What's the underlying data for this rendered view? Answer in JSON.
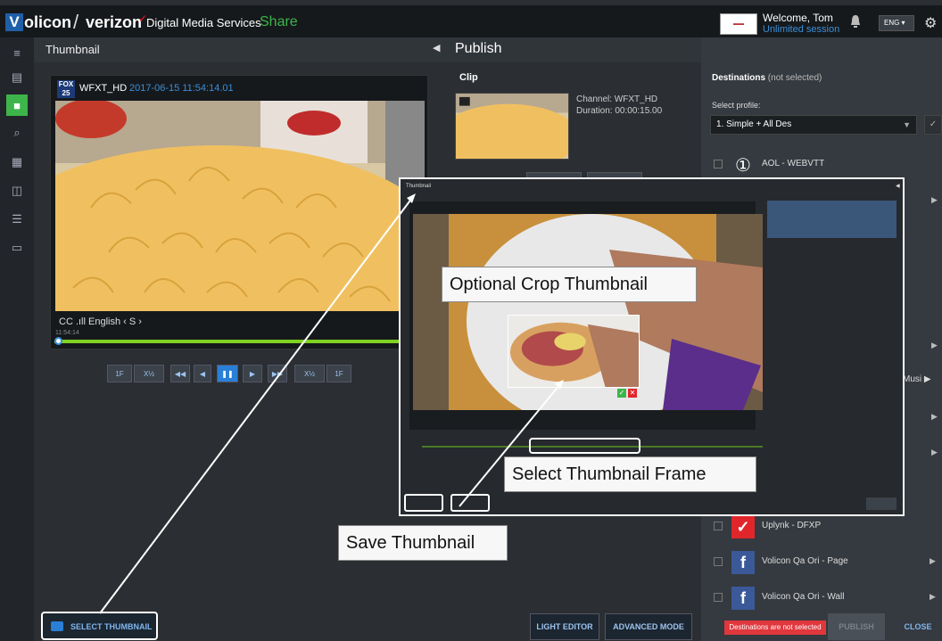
{
  "topbar": {
    "logo_letter": "V",
    "brand": "olicon",
    "brand_sep": "/",
    "brand2": "verizon",
    "brand2_mark": "✓",
    "service": "Digital Media Services",
    "share": "Share",
    "welcome": "Welcome, Tom",
    "session": "Unlimited session",
    "lang": "ENG ▾",
    "gear": "⚙"
  },
  "thumbnail_panel": {
    "title": "Thumbnail",
    "channel_logo": "FOX 25",
    "channel": "WFXT_HD",
    "timestamp": "2017-06-15 11:54:14.01",
    "controls": "CC  .ıll  English  ‹ S ›",
    "timecode": "11:54:14",
    "transport": {
      "back_1f": "1F",
      "slow_back": "X½",
      "rewind": "◀◀",
      "step_back": "◀",
      "pause": "❚❚",
      "play": "▶",
      "ffwd": "▶▶",
      "slow_fwd": "X½",
      "fwd_1f": "1F"
    },
    "select_thumbnail": "SELECT THUMBNAIL"
  },
  "publish_panel": {
    "title": "Publish",
    "clip_label": "Clip",
    "clip_channel": "Channel: WFXT_HD",
    "clip_duration": "Duration: 00:00:15.00",
    "light_editor": "LIGHT EDITOR",
    "advanced_mode": "ADVANCED MODE"
  },
  "destinations": {
    "heading": "Destinations",
    "heading_note": "(not selected)",
    "profile_label": "Select profile:",
    "profile_value": "1. Simple + All Des",
    "items": [
      {
        "icon": "①",
        "label": "AOL - WEBVTT"
      },
      {
        "icon": "✓",
        "label": "Uplynk - DFXP"
      },
      {
        "icon": "f",
        "label": "Volicon Qa Ori - Page"
      },
      {
        "icon": "f",
        "label": "Volicon Qa Ori - Wall"
      }
    ],
    "partial_label": "Musi",
    "not_selected": "Destinations are not selected",
    "publish": "PUBLISH",
    "close": "CLOSE"
  },
  "popup": {
    "title": "Thumbnail"
  },
  "callouts": {
    "crop": "Optional Crop Thumbnail",
    "frame": "Select Thumbnail Frame",
    "save": "Save Thumbnail"
  },
  "colors": {
    "accent_blue": "#2a7fd6",
    "accent_green": "#3db54a",
    "progress_green": "#7ed321",
    "alert_red": "#e0373d"
  }
}
